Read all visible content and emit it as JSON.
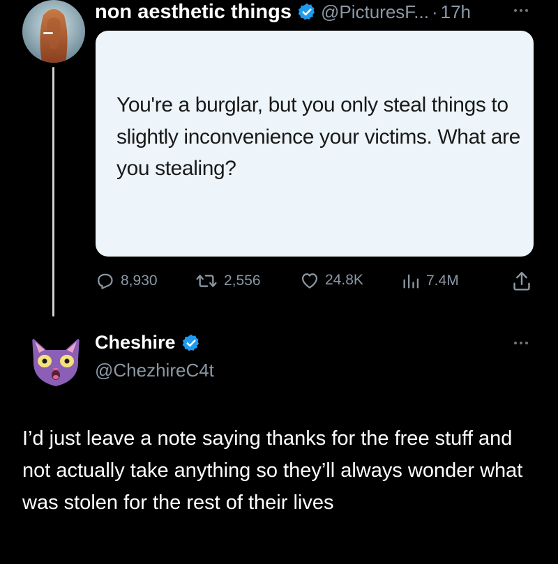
{
  "post": {
    "author_name": "non aesthetic things",
    "handle": "@PicturesF...",
    "separator": "·",
    "time": "17h",
    "avatar_icon": "woman-red-hair-avatar",
    "card_text": "You're a burglar, but you only steal things to slightly inconvenience your victims. What are you stealing?",
    "stats": {
      "replies": "8,930",
      "retweets": "2,556",
      "likes": "24.8K",
      "views": "7.4M"
    }
  },
  "reply": {
    "author_name": "Cheshire",
    "handle": "@ChezhireC4t",
    "avatar_icon": "purple-cat-avatar",
    "text": "I’d just leave a note saying thanks for the free stuff and not actually take anything so they’ll always wonder what was stolen for the rest of their lives"
  },
  "colors": {
    "background": "#000000",
    "muted_text": "#8b98a5",
    "verified_blue": "#1d9bf0",
    "card_background": "#edf5fa"
  }
}
